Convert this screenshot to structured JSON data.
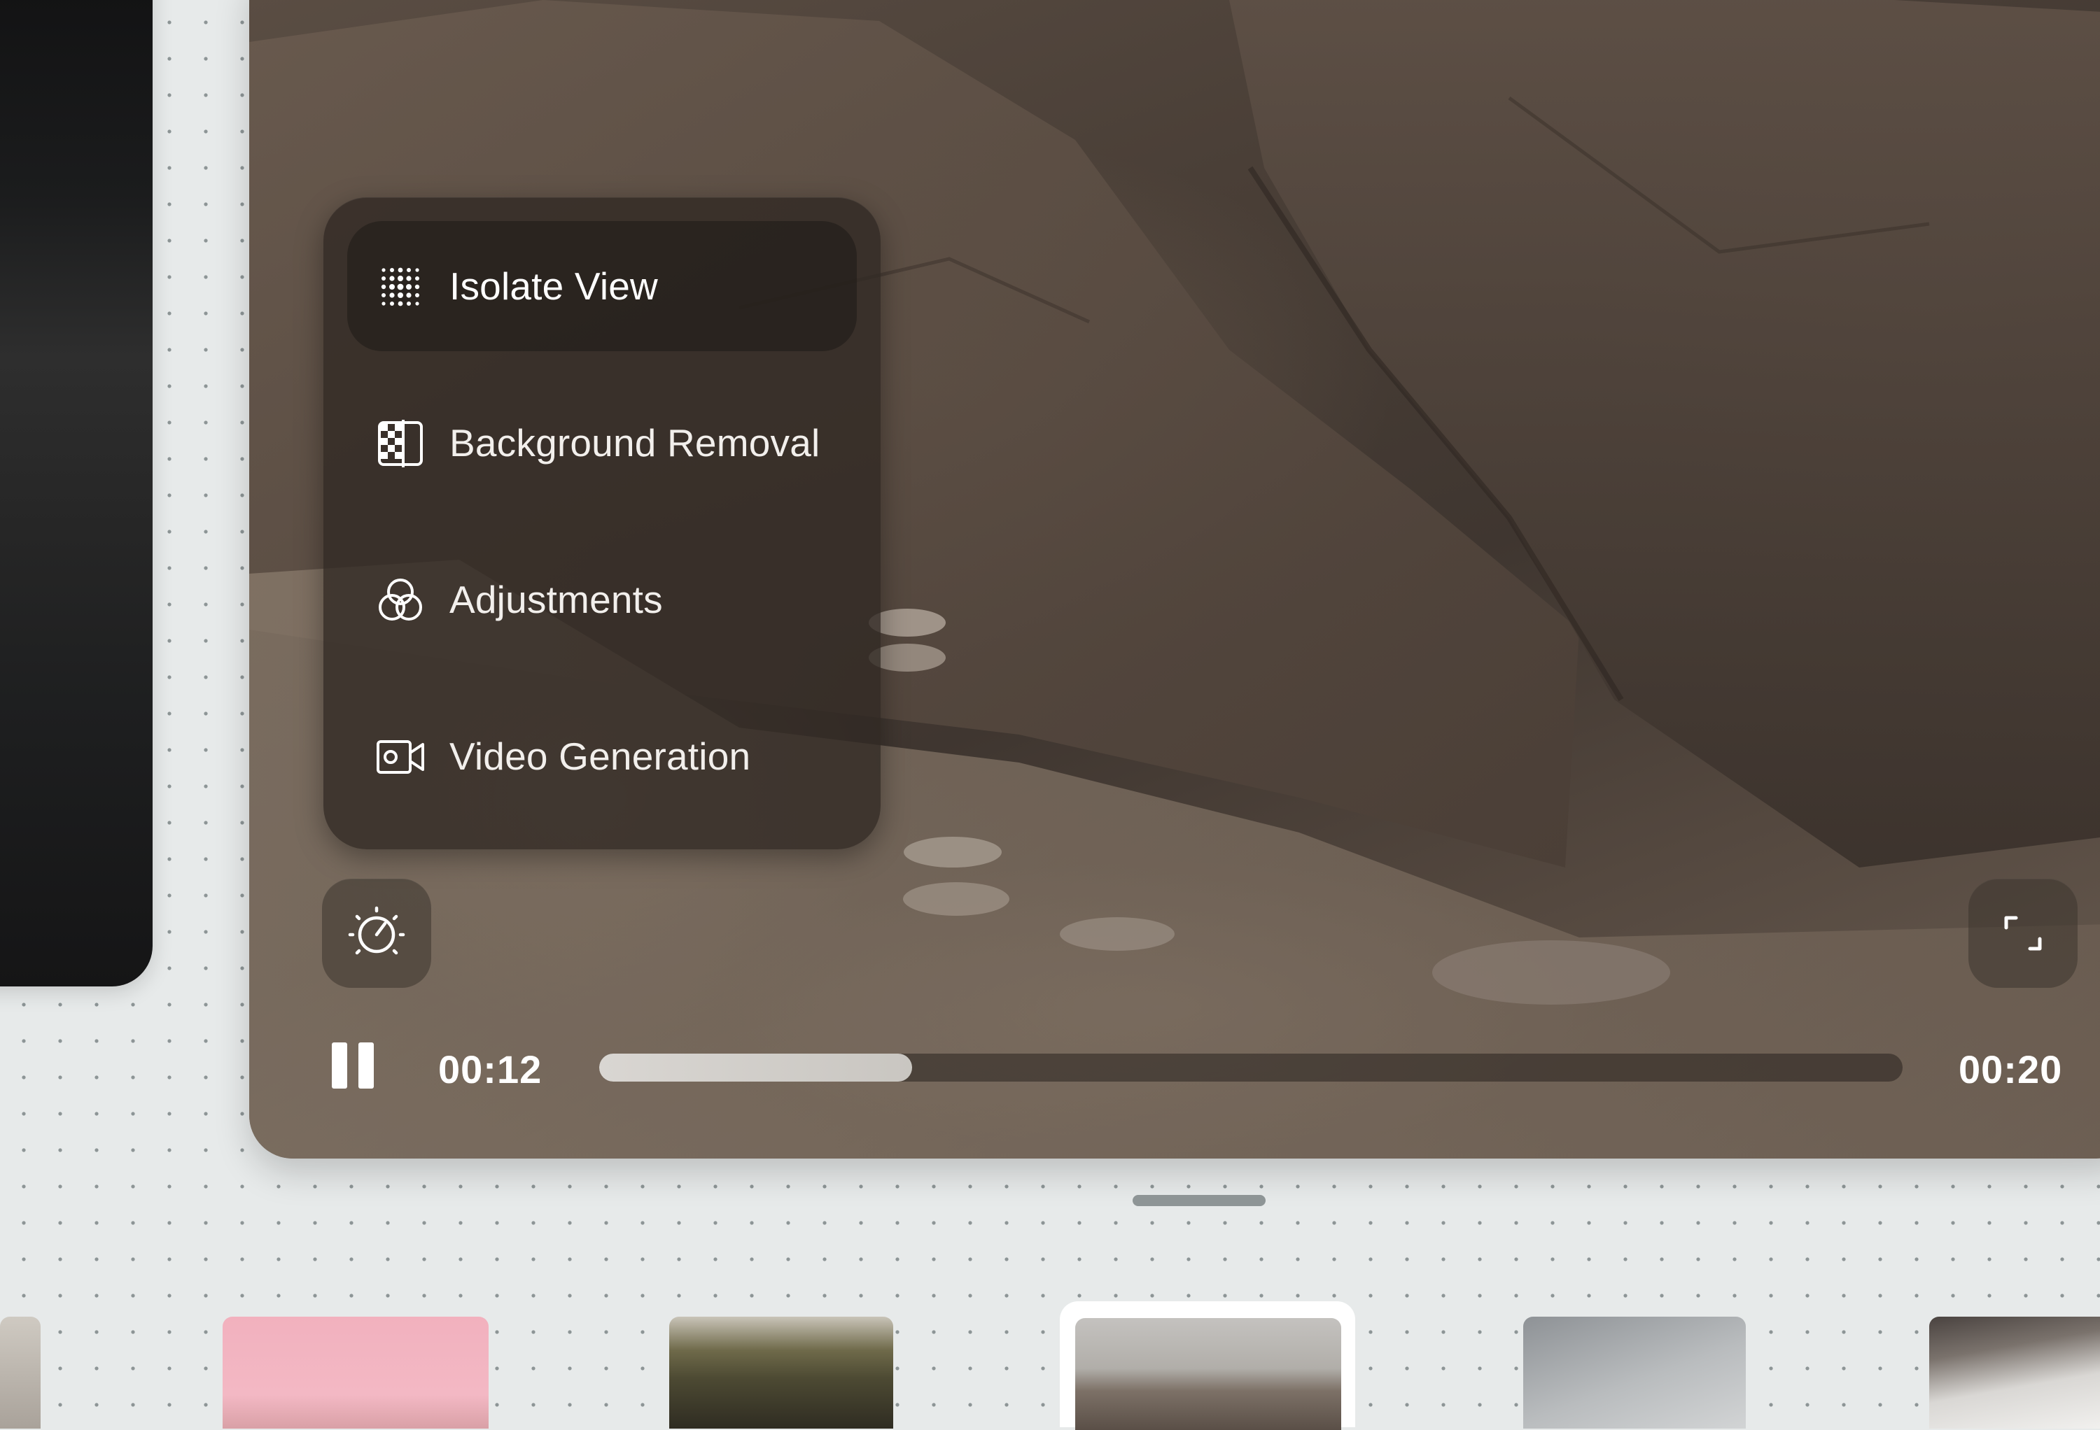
{
  "menu": {
    "items": [
      {
        "label": "Isolate View",
        "icon": "dot-grid-icon",
        "active": true
      },
      {
        "label": "Background Removal",
        "icon": "background-removal-icon",
        "active": false
      },
      {
        "label": "Adjustments",
        "icon": "adjustments-icon",
        "active": false
      },
      {
        "label": "Video Generation",
        "icon": "video-camera-icon",
        "active": false
      }
    ]
  },
  "player": {
    "current_time": "00:12",
    "total_time": "00:20",
    "progress": 0.24,
    "state": "playing"
  },
  "controls": {
    "left_button_icon": "exposure-dial-icon",
    "right_button_icon": "fullscreen-icon"
  },
  "thumbnails": [
    {
      "name": "thumbnail-1"
    },
    {
      "name": "thumbnail-pink"
    },
    {
      "name": "thumbnail-rocks-green"
    },
    {
      "name": "thumbnail-rocks-selected",
      "selected": true
    },
    {
      "name": "thumbnail-grey"
    },
    {
      "name": "thumbnail-car"
    }
  ]
}
